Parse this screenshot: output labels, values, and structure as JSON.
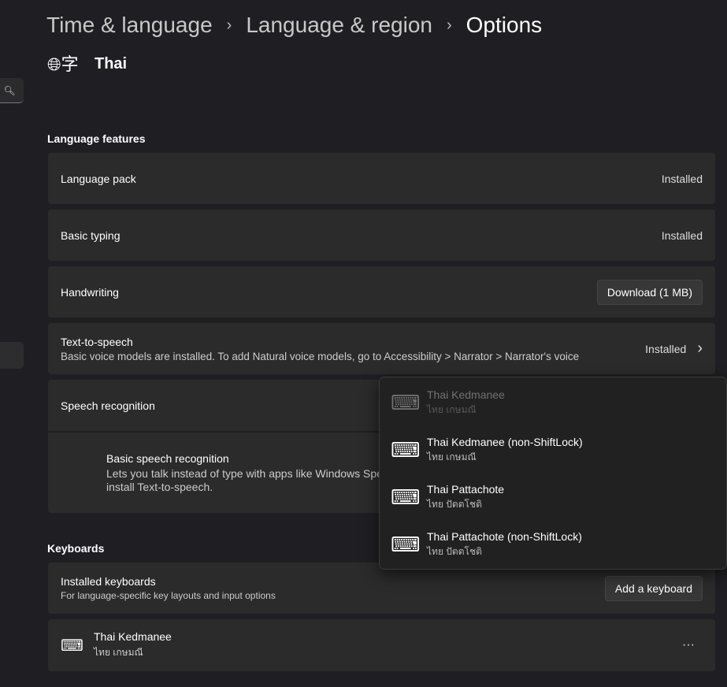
{
  "breadcrumb": [
    "Time & language",
    "Language & region",
    "Options"
  ],
  "language": {
    "name": "Thai"
  },
  "sections": {
    "features": "Language features",
    "keyboards": "Keyboards"
  },
  "features": [
    {
      "title": "Language pack",
      "status": "Installed"
    },
    {
      "title": "Basic typing",
      "status": "Installed"
    },
    {
      "title": "Handwriting",
      "button": "Download (1 MB)"
    },
    {
      "title": "Text-to-speech",
      "desc": "Basic voice models are installed. To add Natural voice models, go to Accessibility > Narrator > Narrator's voice",
      "status": "Installed"
    },
    {
      "title": "Speech recognition"
    }
  ],
  "speech_detail": {
    "title": "Basic speech recognition",
    "desc1": "Lets you talk instead of type with apps like Windows Spe",
    "desc2": "install Text-to-speech."
  },
  "installed_keyboards": {
    "title": "Installed keyboards",
    "desc": "For language-specific key layouts and input options",
    "button": "Add a keyboard"
  },
  "keyboard": {
    "name": "Thai Kedmanee",
    "native": "ไทย เกษมณี",
    "more": "···"
  },
  "flyout": [
    {
      "name": "Thai Kedmanee",
      "native": "ไทย เกษมณี",
      "disabled": true
    },
    {
      "name": "Thai Kedmanee (non-ShiftLock)",
      "native": "ไทย เกษมณี"
    },
    {
      "name": "Thai Pattachote",
      "native": "ไทย ปัตตโชติ"
    },
    {
      "name": "Thai Pattachote (non-ShiftLock)",
      "native": "ไทย ปัตตโชติ"
    }
  ]
}
